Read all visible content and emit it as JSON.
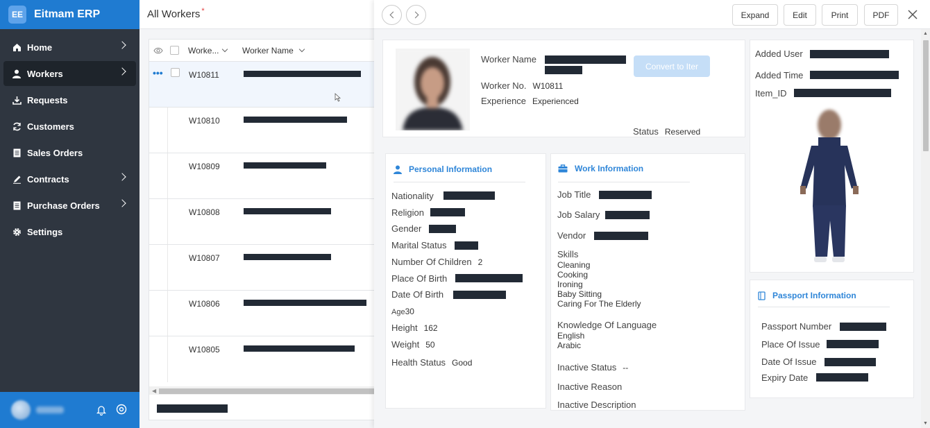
{
  "app": {
    "logo": "EE",
    "name": "Eitmam ERP"
  },
  "sidebar": {
    "items": [
      {
        "label": "Home",
        "icon": "home-icon",
        "chevron": true
      },
      {
        "label": "Workers",
        "icon": "user-icon",
        "chevron": true,
        "active": true
      },
      {
        "label": "Requests",
        "icon": "download-icon",
        "chevron": false
      },
      {
        "label": "Customers",
        "icon": "refresh-icon",
        "chevron": false
      },
      {
        "label": "Sales Orders",
        "icon": "document-icon",
        "chevron": false
      },
      {
        "label": "Contracts",
        "icon": "pen-icon",
        "chevron": true
      },
      {
        "label": "Purchase Orders",
        "icon": "document-icon",
        "chevron": true
      },
      {
        "label": "Settings",
        "icon": "gear-icon",
        "chevron": false
      }
    ]
  },
  "list": {
    "title": "All Workers",
    "required_mark": "*",
    "columns": {
      "worker_no": "Worke...",
      "worker_name": "Worker Name"
    },
    "rows": [
      {
        "worker_no": "W10811",
        "selected": true
      },
      {
        "worker_no": "W10810"
      },
      {
        "worker_no": "W10809"
      },
      {
        "worker_no": "W10808"
      },
      {
        "worker_no": "W10807"
      },
      {
        "worker_no": "W10806"
      },
      {
        "worker_no": "W10805"
      }
    ],
    "row_actions": "•••"
  },
  "toolbar": {
    "expand": "Expand",
    "edit": "Edit",
    "print": "Print",
    "pdf": "PDF"
  },
  "header_card": {
    "worker_name_label": "Worker Name",
    "worker_no_label": "Worker No.",
    "worker_no": "W10811",
    "experience_label": "Experience",
    "experience": "Experienced",
    "convert_button": "Convert to Iter",
    "status_label": "Status",
    "status": "Reserved"
  },
  "meta_card": {
    "added_user_label": "Added User",
    "added_time_label": "Added Time",
    "item_id_label": "Item_ID"
  },
  "personal": {
    "title": "Personal Information",
    "nationality_label": "Nationality",
    "religion_label": "Religion",
    "gender_label": "Gender",
    "marital_label": "Marital Status",
    "children_label": "Number Of Children",
    "children": "2",
    "birthplace_label": "Place Of Birth",
    "dob_label": "Date Of Birth",
    "age_label": "Age",
    "age": "30",
    "height_label": "Height",
    "height": "162",
    "weight_label": "Weight",
    "weight": "50",
    "health_label": "Health Status",
    "health": "Good"
  },
  "work": {
    "title": "Work Information",
    "job_title_label": "Job Title",
    "job_salary_label": "Job Salary",
    "vendor_label": "Vendor",
    "skills_label": "Skills",
    "skills": [
      "Cleaning",
      "Cooking",
      "Ironing",
      "Baby Sitting",
      "Caring For The Elderly"
    ],
    "language_label": "Knowledge Of Language",
    "languages": [
      "English",
      "Arabic"
    ],
    "inactive_status_label": "Inactive Status",
    "inactive_status": "--",
    "inactive_reason_label": "Inactive Reason",
    "inactive_description_label": "Inactive Description"
  },
  "passport": {
    "title": "Passport Information",
    "number_label": "Passport Number",
    "place_label": "Place Of Issue",
    "date_label": "Date Of Issue",
    "expiry_label": "Expiry Date"
  },
  "colors": {
    "brand": "#1f7bd1",
    "sidebar": "#2f3640",
    "accent": "#2f86d8",
    "redaction": "#222a35"
  }
}
